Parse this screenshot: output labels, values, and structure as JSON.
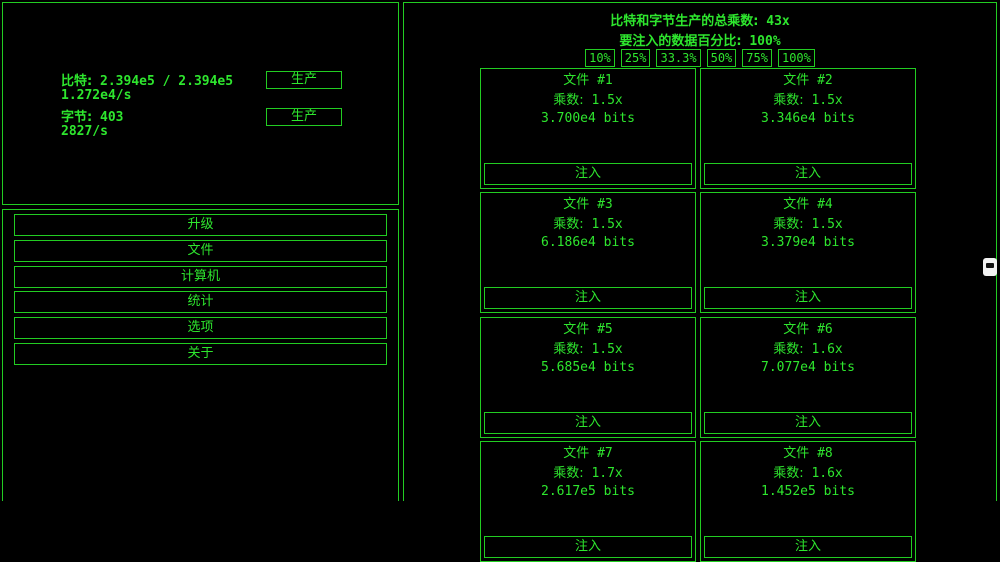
{
  "production": {
    "bits": {
      "label": "比特:",
      "value": "2.394e5 / 2.394e5",
      "rate": "1.272e4/s",
      "button": "生产"
    },
    "bytes": {
      "label": "字节:",
      "value": "403",
      "rate": "2827/s",
      "button": "生产"
    }
  },
  "nav": [
    "升级",
    "文件",
    "计算机",
    "统计",
    "选项",
    "关于"
  ],
  "header": {
    "multiplier_label": "比特和字节生产的总乘数:",
    "multiplier_value": "43x",
    "inject_percent_label": "要注入的数据百分比:",
    "inject_percent_value": "100%"
  },
  "percent_options": [
    "10%",
    "25%",
    "33.3%",
    "50%",
    "75%",
    "100%"
  ],
  "files": [
    {
      "name": "文件",
      "num": "#1",
      "mult_label": "乘数:",
      "mult": "1.5x",
      "bits": "3.700e4 bits",
      "button": "注入"
    },
    {
      "name": "文件",
      "num": "#2",
      "mult_label": "乘数:",
      "mult": "1.5x",
      "bits": "3.346e4 bits",
      "button": "注入"
    },
    {
      "name": "文件",
      "num": "#3",
      "mult_label": "乘数:",
      "mult": "1.5x",
      "bits": "6.186e4 bits",
      "button": "注入"
    },
    {
      "name": "文件",
      "num": "#4",
      "mult_label": "乘数:",
      "mult": "1.5x",
      "bits": "3.379e4 bits",
      "button": "注入"
    },
    {
      "name": "文件",
      "num": "#5",
      "mult_label": "乘数:",
      "mult": "1.5x",
      "bits": "5.685e4 bits",
      "button": "注入"
    },
    {
      "name": "文件",
      "num": "#6",
      "mult_label": "乘数:",
      "mult": "1.6x",
      "bits": "7.077e4 bits",
      "button": "注入"
    },
    {
      "name": "文件",
      "num": "#7",
      "mult_label": "乘数:",
      "mult": "1.7x",
      "bits": "2.617e5 bits",
      "button": "注入"
    },
    {
      "name": "文件",
      "num": "#8",
      "mult_label": "乘数:",
      "mult": "1.6x",
      "bits": "1.452e5 bits",
      "button": "注入"
    }
  ],
  "colors": {
    "accent": "#2ee62e",
    "border": "#22cc22",
    "background": "#000000"
  }
}
